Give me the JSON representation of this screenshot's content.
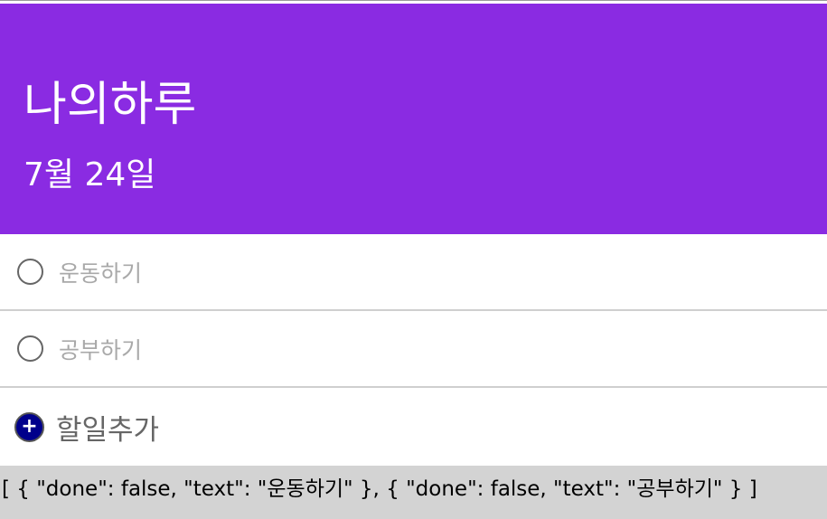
{
  "header": {
    "title": "나의하루",
    "date": "7월 24일"
  },
  "todos": [
    {
      "text": "운동하기",
      "done": false
    },
    {
      "text": "공부하기",
      "done": false
    }
  ],
  "add": {
    "icon": "+",
    "label": "할일추가"
  },
  "json_output": "[ { \"done\": false, \"text\": \"운동하기\" }, { \"done\": false, \"text\": \"공부하기\" } ]",
  "colors": {
    "header_bg": "#8a2be2",
    "add_icon_bg": "#00008b",
    "json_bg": "#d3d3d3"
  }
}
